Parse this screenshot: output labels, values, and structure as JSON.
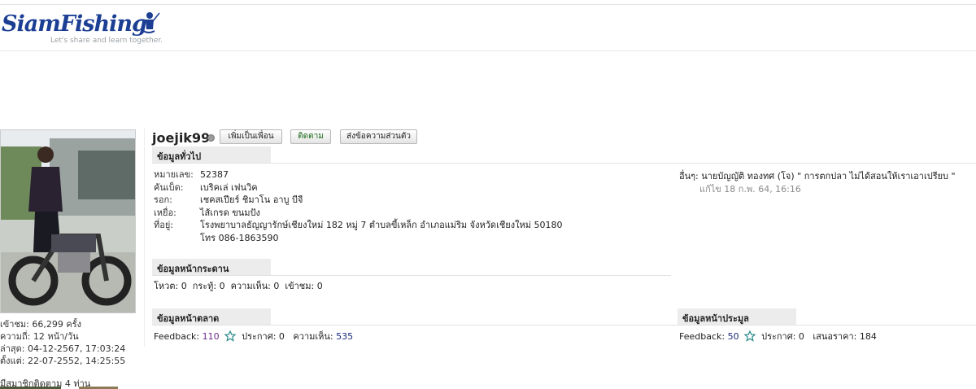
{
  "logo": {
    "brand": "SiamFishing",
    "tagline": "Let's share and learn together."
  },
  "profile": {
    "username": "joejik99",
    "buttons": {
      "add_friend": "เพิ่มเป็นเพื่อน",
      "follow": "ติดตาม",
      "message": "ส่งข้อความส่วนตัว"
    }
  },
  "left": {
    "views": "เข้าชม: 66,299 ครั้ง",
    "frequency": "ความถี่: 12 หน้า/วัน",
    "last": "ล่าสุด: 04-12-2567, 17:03:24",
    "since": "ตั้งแต่: 22-07-2552, 14:25:55",
    "followers": "มีสมาชิกติดตาม 4 ท่าน"
  },
  "general": {
    "title": "ข้อมูลทั่วไป",
    "rows": [
      {
        "label": "หมายเลข:",
        "value": "52387"
      },
      {
        "label": "คันเบ็ด:",
        "value": "เบริคเล่ เฟนวิค"
      },
      {
        "label": "รอก:",
        "value": "เชคสเปียร์ ชิมาโน อาบู บีจี"
      },
      {
        "label": "เหยื่อ:",
        "value": "ไส้เกรด ขนมปัง"
      },
      {
        "label": "ที่อยู่:",
        "value": "โรงพยาบาลธัญญารักษ์เชียงใหม่ 182 หมู่ 7 ตำบลขี้เหล็ก อำเภอแม่ริม จังหวัดเชียงใหม่ 50180"
      },
      {
        "label": "",
        "value": "โทร 086-1863590"
      }
    ],
    "other": "อื่นๆ: นายบัญญัติ ทองทศ (โจ) \" การตกปลา ไม่ได้สอนให้เราเอาเปรียบ \"",
    "edited": "แก้ไข 18 ก.พ. 64, 16:16"
  },
  "board": {
    "title": "ข้อมูลหน้ากระดาน",
    "votes_label": "โหวต:",
    "votes": "0",
    "topics_label": "กระทู้:",
    "topics": "0",
    "comments_label": "ความเห็น:",
    "comments": "0",
    "visits_label": "เข้าชม:",
    "visits": "0"
  },
  "market": {
    "title": "ข้อมูลหน้าตลาด",
    "feedback_label": "Feedback:",
    "feedback": "110",
    "announce_label": "ประกาศ:",
    "announce": "0",
    "comments_label": "ความเห็น:",
    "comments": "535"
  },
  "auction": {
    "title": "ข้อมูลหน้าประมูล",
    "feedback_label": "Feedback:",
    "feedback": "50",
    "announce_label": "ประกาศ:",
    "announce": "0",
    "bid_label": "เสนอราคา:",
    "bid": "184"
  },
  "colors": {
    "brand": "#1c3f94",
    "section_bg": "#ececec",
    "star": "#2a8a8a"
  }
}
